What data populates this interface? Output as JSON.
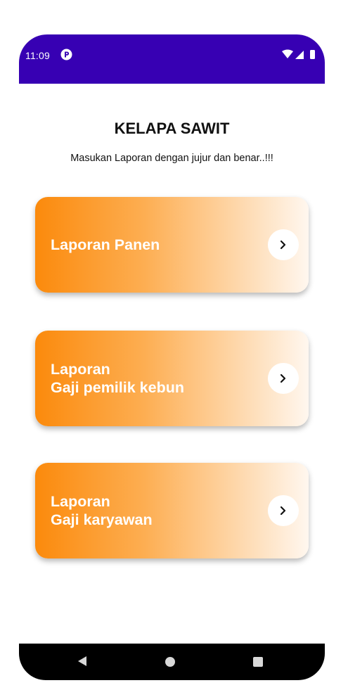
{
  "status_bar": {
    "time": "11:09",
    "app_icon": "app-badge-icon",
    "wifi_icon": "wifi-icon",
    "signal_icon": "signal-icon",
    "battery_icon": "battery-icon",
    "background": "#3700B3"
  },
  "header": {
    "title": "KELAPA SAWIT",
    "subtitle": "Masukan Laporan dengan jujur dan benar..!!!"
  },
  "menu": {
    "items": [
      {
        "line1": "Laporan Panen",
        "line2": "",
        "icon": "chevron-right-icon"
      },
      {
        "line1": "Laporan",
        "line2": "Gaji pemilik kebun",
        "icon": "chevron-right-icon"
      },
      {
        "line1": "Laporan",
        "line2": "Gaji karyawan",
        "icon": "chevron-right-icon"
      }
    ],
    "gradient_start": "#fb8a0c",
    "gradient_end": "#fff7ef"
  },
  "nav_bar": {
    "back_icon": "back-triangle-icon",
    "home_icon": "home-circle-icon",
    "recents_icon": "recents-square-icon"
  }
}
